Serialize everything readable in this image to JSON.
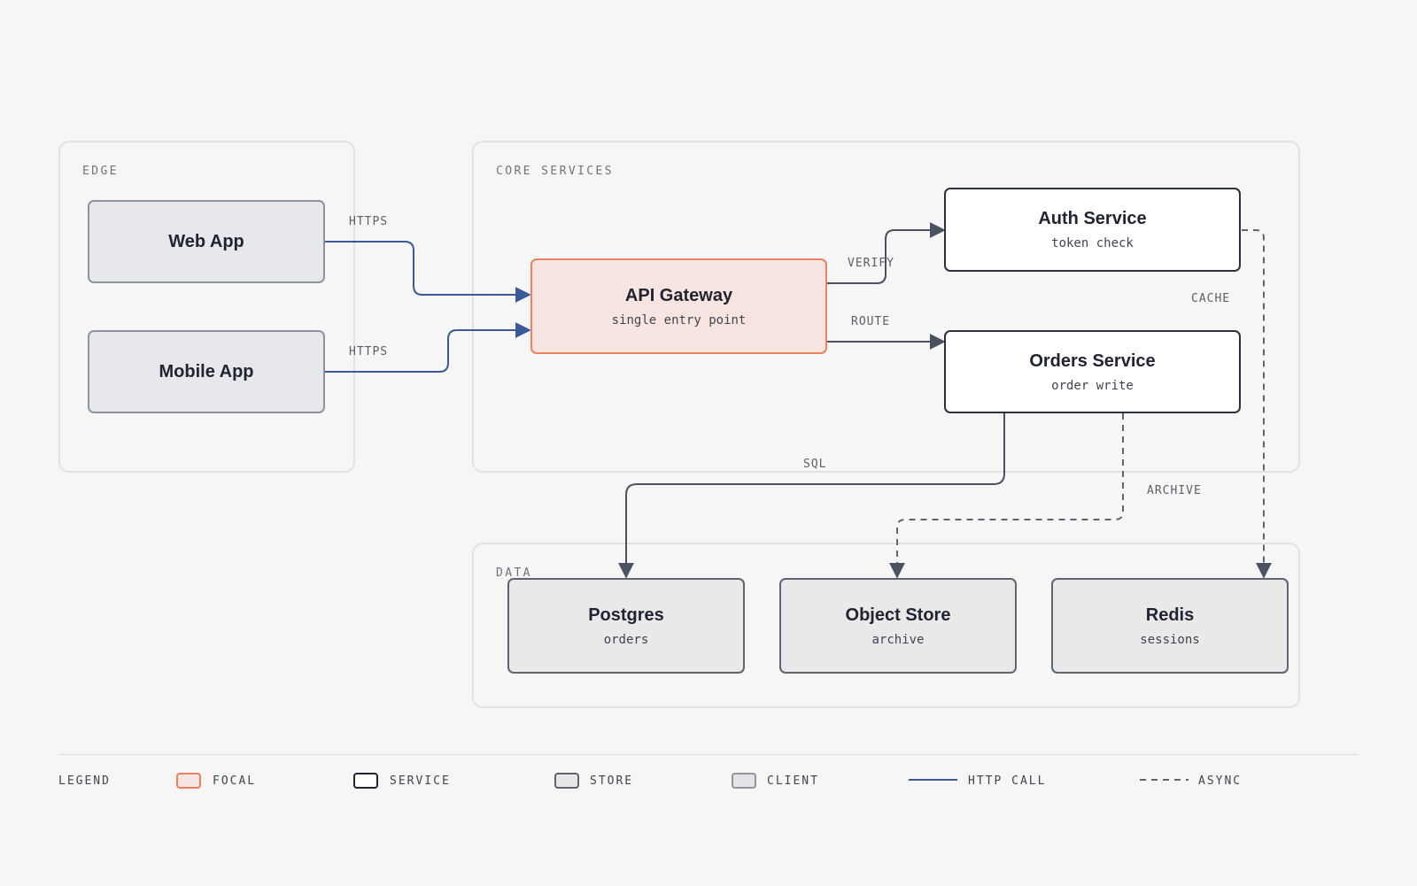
{
  "colors": {
    "background": "#f6f6f6",
    "focal_fill": "#f8e5e1",
    "focal_border": "#e8825f",
    "http_line": "#3b5998",
    "service_line": "#4a5160",
    "async_line": "#5f6570"
  },
  "groups": {
    "edge": "EDGE",
    "core": "CORE SERVICES",
    "data": "DATA"
  },
  "nodes": {
    "web_app": {
      "title": "Web App"
    },
    "mobile_app": {
      "title": "Mobile App"
    },
    "api_gateway": {
      "title": "API Gateway",
      "subtitle": "single entry point"
    },
    "auth_service": {
      "title": "Auth Service",
      "subtitle": "token check"
    },
    "orders_service": {
      "title": "Orders Service",
      "subtitle": "order write"
    },
    "postgres": {
      "title": "Postgres",
      "subtitle": "orders"
    },
    "object_store": {
      "title": "Object Store",
      "subtitle": "archive"
    },
    "redis": {
      "title": "Redis",
      "subtitle": "sessions"
    }
  },
  "edges": {
    "web_https": "HTTPS",
    "mobile_https": "HTTPS",
    "verify": "VERIFY",
    "route": "ROUTE",
    "cache": "CACHE",
    "sql": "SQL",
    "archive": "ARCHIVE"
  },
  "legend": {
    "title": "LEGEND",
    "focal": "FOCAL",
    "service": "SERVICE",
    "store": "STORE",
    "client": "CLIENT",
    "http_call": "HTTP CALL",
    "async": "ASYNC"
  }
}
